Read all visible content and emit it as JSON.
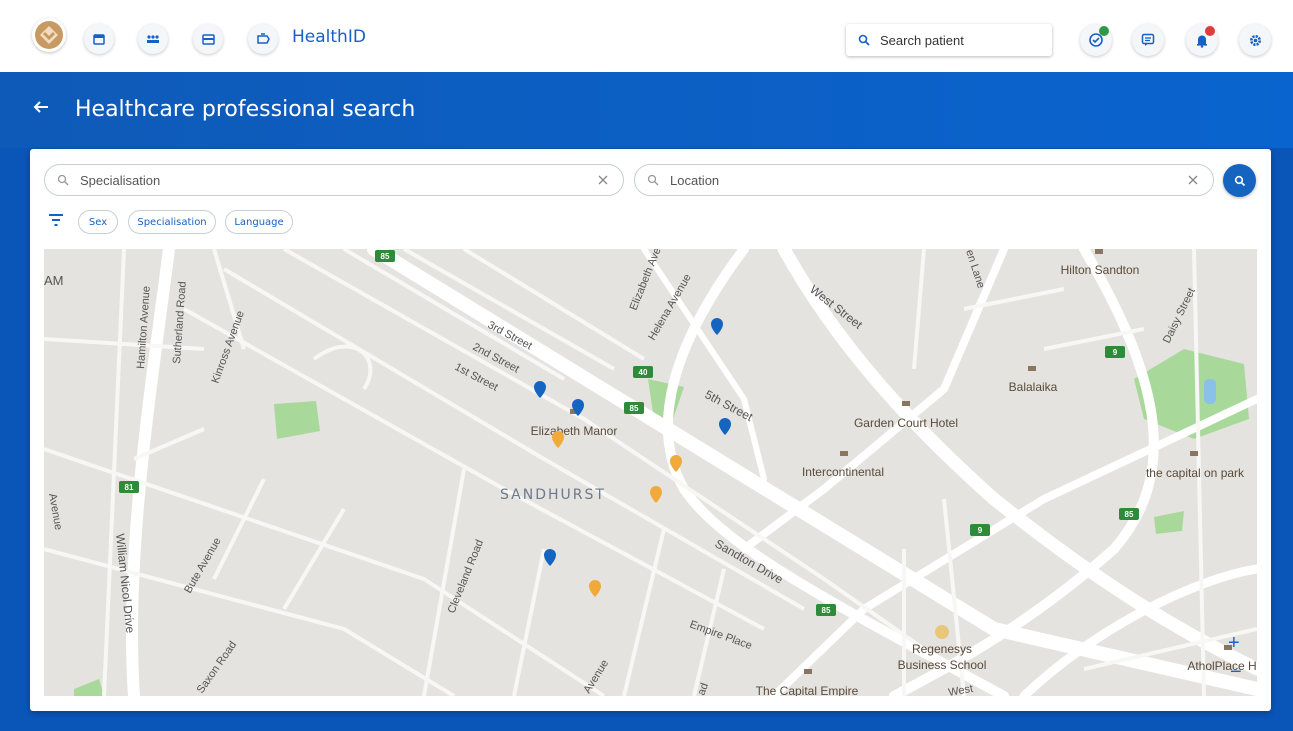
{
  "app": {
    "title": "HealthID"
  },
  "topbar": {
    "search_placeholder": "Search patient",
    "nav_icons": [
      "calendar-icon",
      "people-icon",
      "card-icon",
      "briefcase-icon"
    ],
    "right_icons": [
      "health-check-icon",
      "chat-icon",
      "bell-icon",
      "gear-icon"
    ],
    "status_colors": {
      "health_dot": "#2e9a47",
      "bell_dot": "#e23b3b"
    }
  },
  "page": {
    "title": "Healthcare professional search"
  },
  "search": {
    "specialisation_placeholder": "Specialisation",
    "location_placeholder": "Location"
  },
  "filters": {
    "chips": [
      "Sex",
      "Specialisation",
      "Language"
    ]
  },
  "map": {
    "area_label": "SANDHURST",
    "edge_label": "AM",
    "streets": [
      "Hamilton Avenue",
      "Sutherland Road",
      "Kinross Avenue",
      "3rd Street",
      "2nd Street",
      "1st Street",
      "Elizabeth Ave",
      "Helena Avenue",
      "West Street",
      "5th Street",
      "Sandton Drive",
      "Empire Place",
      "Cleveland Road",
      "Bute Avenue",
      "William Nicol Drive",
      "Daisy Street",
      "Avenue",
      "Saxon Road",
      "Avenue",
      "ad",
      "West",
      "en Lane",
      "venue"
    ],
    "places": [
      "Elizabeth Manor",
      "Garden Court Hotel",
      "Intercontinental",
      "Balalaika",
      "Hilton Sandton",
      "the capital on park",
      "Regenesys",
      "Business School",
      "The Capital Empire",
      "AtholPlace H"
    ],
    "route_shields": [
      "85",
      "40",
      "85",
      "81",
      "9",
      "9",
      "85",
      "85"
    ],
    "zoom_in": "+",
    "zoom_out": "−",
    "colors": {
      "pin_blue": "#1565c0",
      "pin_orange": "#f0a93b",
      "road": "#ffffff",
      "park": "#a8d99a",
      "shield": "#2e8b3a"
    }
  }
}
